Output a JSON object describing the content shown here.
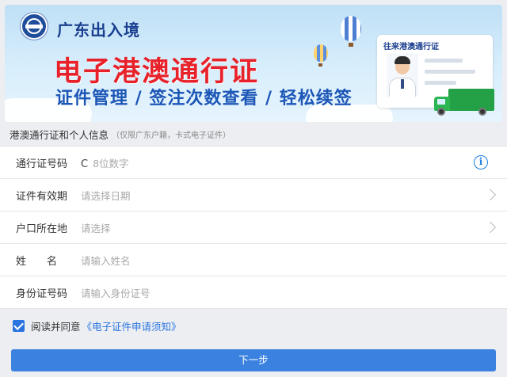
{
  "banner": {
    "brand": "广东出入境",
    "title": "电子港澳通行证",
    "subtitle": "证件管理 / 签注次数查看 / 轻松续签",
    "card_heading": "往来港澳通行证"
  },
  "section": {
    "title": "港澳通行证和个人信息",
    "note": "（仅限广东户籍，卡式电子证件）"
  },
  "form": {
    "rows": [
      {
        "label": "通行证号码",
        "prefix": "C",
        "placeholder": "8位数字",
        "trailing_icon": "info-icon"
      },
      {
        "label": "证件有效期",
        "placeholder": "请选择日期",
        "trailing_icon": "chevron-right-icon"
      },
      {
        "label": "户口所在地",
        "placeholder": "请选择",
        "trailing_icon": "chevron-right-icon"
      },
      {
        "label": "姓名",
        "placeholder": "请输入姓名"
      },
      {
        "label": "身份证号码",
        "placeholder": "请输入身份证号"
      }
    ]
  },
  "agreement": {
    "checked": true,
    "text": "阅读并同意",
    "link": "《电子证件申请须知》"
  },
  "next_button": "下一步",
  "colors": {
    "accent": "#3b82e0",
    "title_red": "#e8222a",
    "brand_blue": "#1a3f8f",
    "subtitle_blue": "#1c56b6"
  }
}
